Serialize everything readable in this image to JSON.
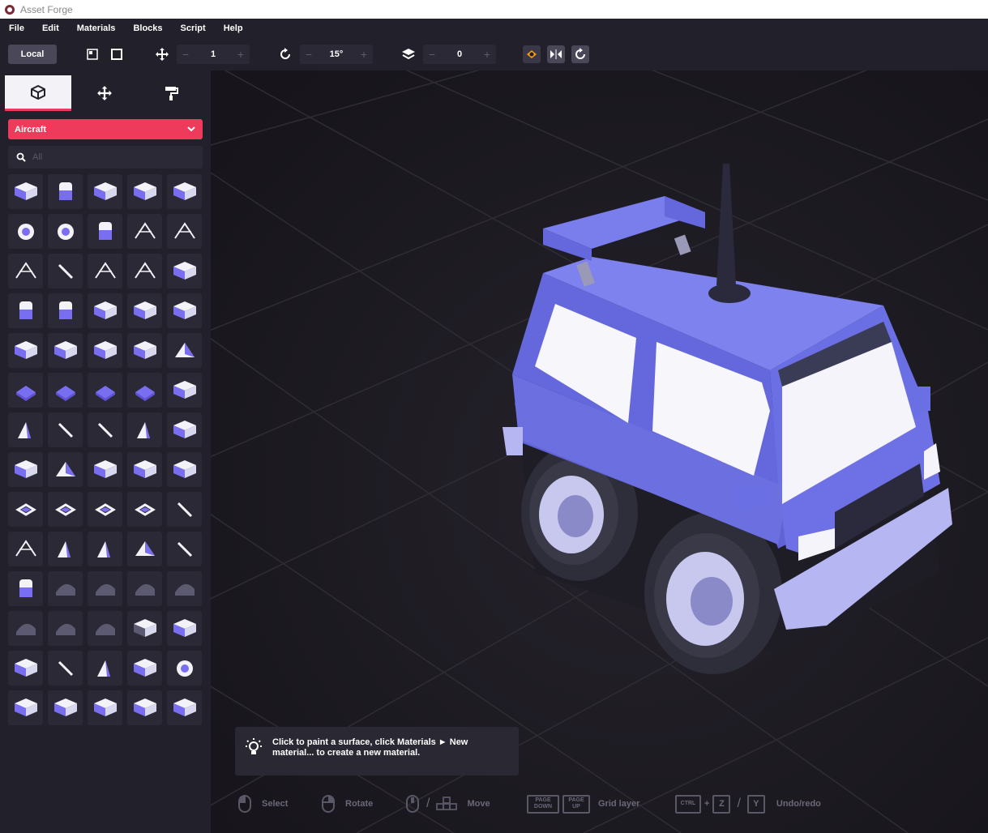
{
  "app": {
    "title": "Asset Forge"
  },
  "menu": [
    "File",
    "Edit",
    "Materials",
    "Blocks",
    "Script",
    "Help"
  ],
  "toolbar": {
    "local_label": "Local",
    "grid_step": "1",
    "rotation_step": "15°",
    "layer_value": "0",
    "minus": "−",
    "plus": "+"
  },
  "sidebar": {
    "tabs": [
      "blocks-tab",
      "transform-tab",
      "paint-tab"
    ],
    "category": "Aircraft",
    "search_placeholder": "All"
  },
  "viewport": {
    "hint": "Click to paint a surface, click Materials ► New material... to create a new material.",
    "controls": {
      "select": "Select",
      "rotate": "Rotate",
      "move": "Move",
      "grid_layer": "Grid layer",
      "page_down": "PAGE DOWN",
      "page_up": "PAGE UP",
      "ctrl": "CTRL",
      "z": "Z",
      "y": "Y",
      "undo_redo": "Undo/redo",
      "plus_sep": "+",
      "slash": "/"
    }
  },
  "colors": {
    "accent": "#ee3b5c",
    "block_purple": "#7a6ef0",
    "vehicle_body": "#6b6fe0"
  }
}
